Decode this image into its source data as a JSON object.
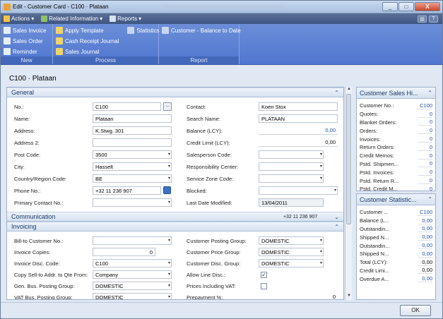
{
  "window": {
    "title": "Edit - Customer Card - C100 · Plataan",
    "min": "_",
    "max": "□",
    "close": "X"
  },
  "menubar": {
    "items": [
      {
        "label": "Actions",
        "icon": "lightning-icon",
        "color": "#f5c542"
      },
      {
        "label": "Related Information",
        "icon": "related-icon",
        "color": "#8fc06b"
      },
      {
        "label": "Reports",
        "icon": "report-icon",
        "color": "#d8e2f2"
      }
    ],
    "right_buttons": [
      "▤",
      "?"
    ]
  },
  "ribbon": {
    "groups": [
      {
        "label": "New",
        "cols": [
          [
            {
              "label": "Sales Invoice",
              "color": "#e6eefc"
            },
            {
              "label": "Sales Order",
              "color": "#e6eefc"
            },
            {
              "label": "Reminder",
              "color": "#e6eefc"
            }
          ]
        ]
      },
      {
        "label": "Process",
        "cols": [
          [
            {
              "label": "Apply Template",
              "color": "#f0d36b"
            },
            {
              "label": "Cash Receipt Journal",
              "color": "#f0d36b"
            },
            {
              "label": "Sales Journal",
              "color": "#f0d36b"
            }
          ],
          [
            {
              "label": "Statistics",
              "color": "#c7d5ef"
            }
          ]
        ]
      },
      {
        "label": "Report",
        "cols": [
          [
            {
              "label": "Customer - Balance to Date",
              "color": "#c7d5ef"
            }
          ]
        ]
      }
    ]
  },
  "card_title": "C100 · Plataan",
  "sections": {
    "general": {
      "title": "General"
    },
    "communication": {
      "title": "Communication",
      "summary": "+32 11 236 907"
    },
    "invoicing": {
      "title": "Invoicing"
    }
  },
  "general": {
    "no_label": "No.:",
    "no": "C100",
    "name_label": "Name:",
    "name": "Plataan",
    "address_label": "Address:",
    "address": "K.Stwg. 301",
    "address2_label": "Address 2:",
    "address2": "",
    "post_code_label": "Post Code:",
    "post_code": "3500",
    "city_label": "City:",
    "city": "Hasselt",
    "country_label": "Country/Region Code:",
    "country": "BE",
    "phone_label": "Phone No.:",
    "phone": "+32 11 236 907",
    "primary_contact_label": "Primary Contact No.:",
    "primary_contact": "",
    "contact_label": "Contact:",
    "contact": "Koen Stox",
    "search_name_label": "Search Name:",
    "search_name": "PLATAAN",
    "balance_label": "Balance (LCY):",
    "balance": "0,00",
    "credit_limit_label": "Credit Limit (LCY):",
    "credit_limit": "0,00",
    "salesperson_label": "Salesperson Code:",
    "salesperson": "",
    "resp_center_label": "Responsibility Center:",
    "resp_center": "",
    "service_zone_label": "Service Zone Code:",
    "service_zone": "",
    "blocked_label": "Blocked:",
    "blocked": "",
    "last_modified_label": "Last Date Modified:",
    "last_modified": "13/04/2011"
  },
  "invoicing": {
    "bill_to_label": "Bill-to Customer No.:",
    "bill_to": "",
    "invoice_copies_label": "Invoice Copies:",
    "invoice_copies": "0",
    "invoice_disc_label": "Invoice Disc. Code:",
    "invoice_disc": "C100",
    "copy_sell_label": "Copy Sell-to Addr. to Qte From:",
    "copy_sell": "Company",
    "gen_bus_label": "Gen. Bus. Posting Group:",
    "gen_bus": "DOMESTIC",
    "vat_bus_label": "VAT Bus. Posting Group:",
    "vat_bus": "DOMESTIC",
    "cust_posting_label": "Customer Posting Group:",
    "cust_posting": "DOMESTIC",
    "cust_price_label": "Customer Price Group:",
    "cust_price": "DOMESTIC",
    "cust_disc_label": "Customer Disc. Group:",
    "cust_disc": "DOMESTIC",
    "allow_line_disc_label": "Allow Line Disc.:",
    "allow_line_disc": "✓",
    "prices_incl_vat_label": "Prices Including VAT:",
    "prices_incl_vat": "",
    "prepayment_label": "Prepayment %:",
    "prepayment": "0"
  },
  "factbox_history": {
    "title": "Customer Sales Hi...",
    "rows": [
      {
        "k": "Customer No.:",
        "v": "C100"
      },
      {
        "k": "Quotes:",
        "v": "0"
      },
      {
        "k": "Blanket Orders:",
        "v": "0"
      },
      {
        "k": "Orders:",
        "v": "0"
      },
      {
        "k": "Invoices:",
        "v": "0"
      },
      {
        "k": "Return Orders:",
        "v": "0"
      },
      {
        "k": "Credit Memos:",
        "v": "0"
      },
      {
        "k": "Pstd. Shipmen...",
        "v": "0"
      },
      {
        "k": "Pstd. Invoices:",
        "v": "0"
      },
      {
        "k": "Pstd. Return R...",
        "v": "0"
      },
      {
        "k": "Pstd. Credit M...",
        "v": "0"
      }
    ]
  },
  "factbox_stats": {
    "title": "Customer Statistic...",
    "rows": [
      {
        "k": "Customer ...",
        "v": "C100"
      },
      {
        "k": "Balance (L...",
        "v": "0,00"
      },
      {
        "k": "Outstandin...",
        "v": "0,00"
      },
      {
        "k": "Shipped N...",
        "v": "0,00"
      },
      {
        "k": "Outstandin...",
        "v": "0,00"
      },
      {
        "k": "Shipped N...",
        "v": "0,00"
      },
      {
        "k": "Total (LCY):",
        "v": "0,00"
      },
      {
        "k": "Credit Limi...",
        "v": "0,00"
      },
      {
        "k": "Overdue A...",
        "v": "0,00"
      }
    ]
  },
  "footer": {
    "ok": "OK"
  },
  "icons": {
    "ellipsis": "...",
    "dropdown": "▾",
    "collapse": "⌃",
    "expand": "⌄"
  }
}
